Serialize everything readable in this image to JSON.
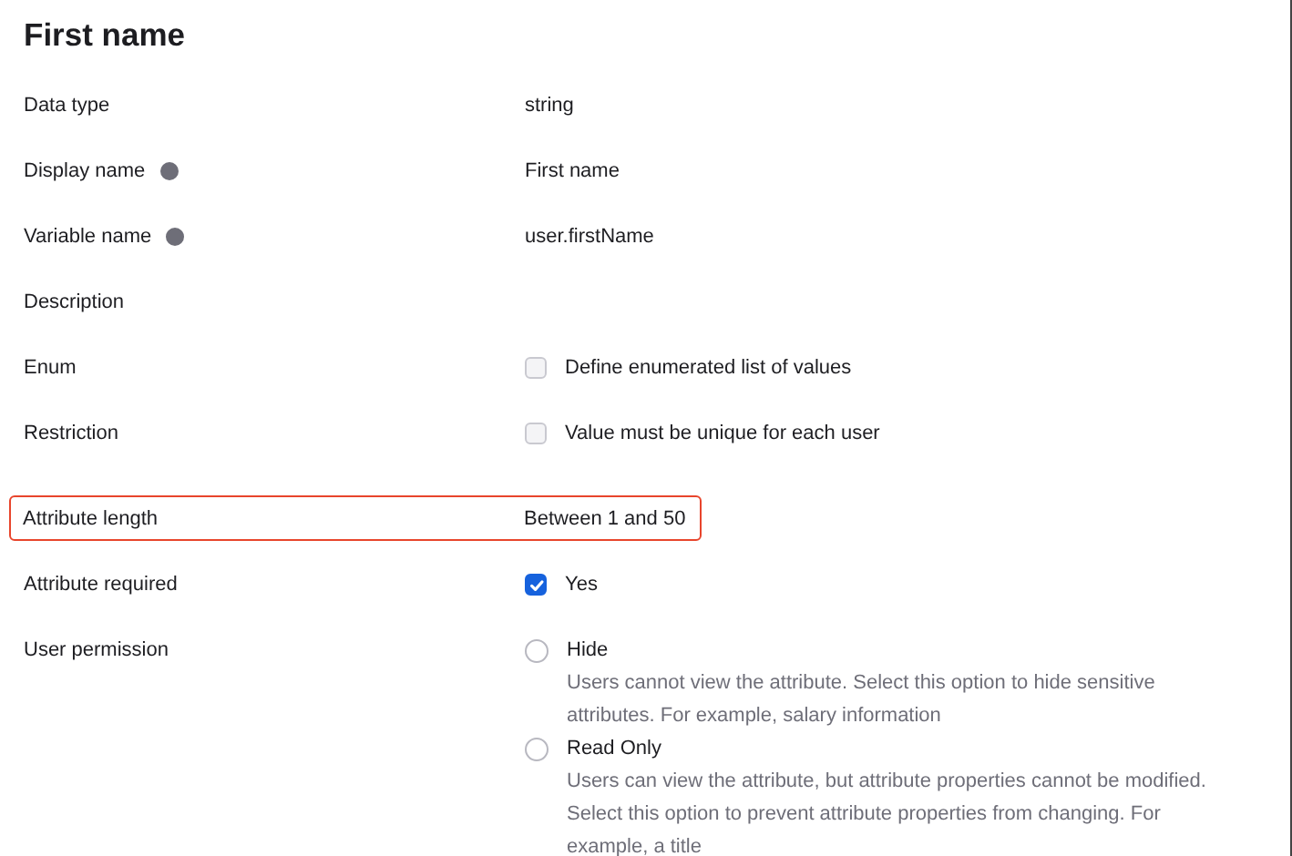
{
  "title": "First name",
  "fields": [
    {
      "kind": "text",
      "label": "Data type",
      "help": false,
      "highlighted": false,
      "value": "string"
    },
    {
      "kind": "text",
      "label": "Display name",
      "help": true,
      "highlighted": false,
      "value": "First name"
    },
    {
      "kind": "text",
      "label": "Variable name",
      "help": true,
      "highlighted": false,
      "value": "user.firstName"
    },
    {
      "kind": "text",
      "label": "Description",
      "help": false,
      "highlighted": false
    },
    {
      "kind": "checkbox",
      "label": "Enum",
      "help": false,
      "highlighted": false,
      "option": "Define enumerated list of values",
      "checked": false
    },
    {
      "kind": "checkbox",
      "label": "Restriction",
      "help": false,
      "highlighted": false,
      "option": "Value must be unique for each user",
      "checked": false
    },
    {
      "kind": "text",
      "label": "Attribute length",
      "help": false,
      "highlighted": true,
      "value": "Between 1 and 50"
    },
    {
      "kind": "checkbox",
      "label": "Attribute required",
      "help": false,
      "highlighted": false,
      "option": "Yes",
      "checked": true
    },
    {
      "kind": "radio",
      "label": "User permission",
      "help": false,
      "highlighted": false,
      "options": [
        {
          "label": "Hide",
          "description": "Users cannot view the attribute. Select this option to hide sensitive attributes. For example, salary information",
          "selected": false
        },
        {
          "label": "Read Only",
          "description": "Users can view the attribute, but attribute properties cannot be modified. Select this option to prevent attribute properties from changing. For example, a title",
          "selected": false
        }
      ]
    }
  ]
}
